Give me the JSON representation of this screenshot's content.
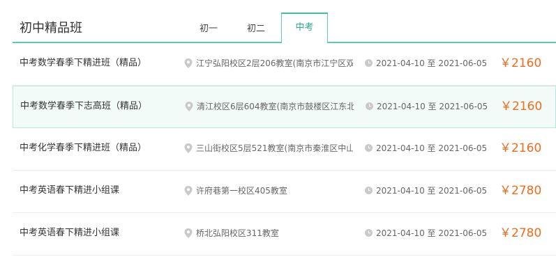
{
  "section": {
    "title": "初中精品班"
  },
  "tabs": [
    {
      "label": "初一"
    },
    {
      "label": "初二"
    },
    {
      "label": "中考"
    }
  ],
  "colors": {
    "accent": "#3fbf9c",
    "price": "#f26a1b"
  },
  "icons": {
    "location": "map-pin-icon",
    "time": "clock-icon"
  },
  "courses": [
    {
      "name": "中考数学春季下精进班（精品）",
      "location": "江宁弘阳校区2层206教室(南京市江宁区双",
      "date": "2021-04-10 至 2021-06-05",
      "price": "￥2160"
    },
    {
      "name": "中考数学春季下志高班（精品）",
      "location": "清江校区6层604教室(南京市鼓楼区江东北",
      "date": "2021-04-10 至 2021-06-05",
      "price": "￥2160"
    },
    {
      "name": "中考化学春季下精进班（精品）",
      "location": "三山街校区5层521教室(南京市秦淮区中山",
      "date": "2021-04-10 至 2021-06-05",
      "price": "￥2160"
    },
    {
      "name": "中考英语春下精进小组课",
      "location": "许府巷第一校区405教室",
      "date": "2021-04-10 至 2021-06-05",
      "price": "￥2780"
    },
    {
      "name": "中考英语春下精进小组课",
      "location": "桥北弘阳校区311教室",
      "date": "2021-04-10 至 2021-06-05",
      "price": "￥2780"
    }
  ]
}
